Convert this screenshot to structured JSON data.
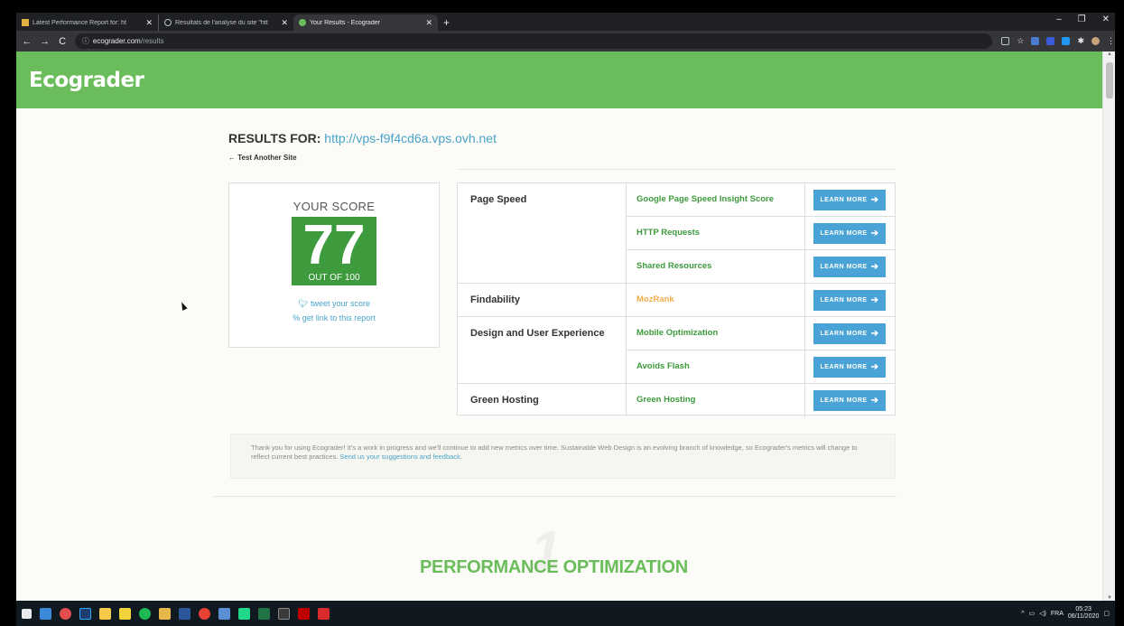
{
  "browser": {
    "tabs": [
      {
        "title": "Latest Performance Report for: ht",
        "active": false
      },
      {
        "title": "Résultats de l'analyse du site \"htt",
        "active": false
      },
      {
        "title": "Your Results - Ecograder",
        "active": true
      }
    ],
    "new_tab_icon": "plus-icon",
    "url_host": "ecograder.com",
    "url_path": "/results"
  },
  "site": {
    "logo": "Ecograder",
    "brand_color": "#6bbd5b",
    "results_label": "RESULTS FOR:",
    "results_url": "http://vps-f9f4cd6a.vps.ovh.net",
    "test_another": "← Test Another Site"
  },
  "score": {
    "label": "YOUR SCORE",
    "value": "77",
    "out_of": "OUT OF 100",
    "tweet": "tweet your score",
    "get_link": "get link to this report"
  },
  "metrics": {
    "learn_more": "LEARN MORE",
    "categories": [
      "Page Speed",
      "Findability",
      "Design and User Experience",
      "Green Hosting"
    ],
    "rows": [
      {
        "name": "Google Page Speed Insight Score",
        "status": "good"
      },
      {
        "name": "HTTP Requests",
        "status": "good"
      },
      {
        "name": "Shared Resources",
        "status": "good"
      },
      {
        "name": "MozRank",
        "status": "warn"
      },
      {
        "name": "Mobile Optimization",
        "status": "good"
      },
      {
        "name": "Avoids Flash",
        "status": "good"
      },
      {
        "name": "Green Hosting",
        "status": "good"
      }
    ]
  },
  "thanks": {
    "text": "Thank you for using Ecograder! It's a work in progress and we'll continue to add new metrics over time. Sustainable Web Design is an evolving branch of knowledge, so Ecograder's metrics will change to reflect current best practices.",
    "link": "Send us your suggestions and feedback."
  },
  "section": {
    "number": "1",
    "title": "PERFORMANCE OPTIMIZATION"
  },
  "taskbar": {
    "language": "FRA",
    "time": "05:23",
    "date": "06/11/2020"
  }
}
